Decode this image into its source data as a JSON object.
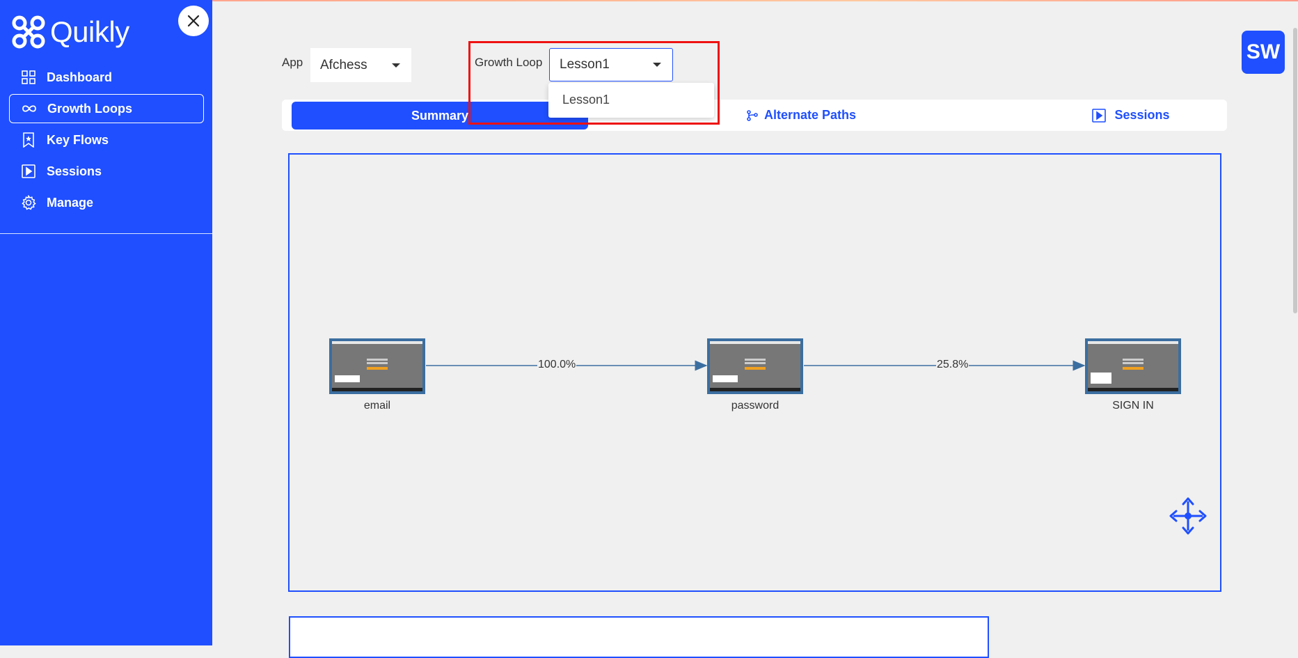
{
  "app_brand": "Quikly",
  "sidebar": {
    "items": [
      {
        "label": "Dashboard",
        "icon": "grid-icon",
        "active": false
      },
      {
        "label": "Growth Loops",
        "icon": "infinity-icon",
        "active": true
      },
      {
        "label": "Key Flows",
        "icon": "bookmark-icon",
        "active": false
      },
      {
        "label": "Sessions",
        "icon": "play-icon",
        "active": false
      },
      {
        "label": "Manage",
        "icon": "gear-icon",
        "active": false
      }
    ]
  },
  "filters": {
    "app_label": "App",
    "app_value": "Afchess",
    "growth_loop_label": "Growth Loop",
    "growth_loop_value": "Lesson1",
    "growth_loop_options": [
      "Lesson1"
    ]
  },
  "tabs": {
    "summary": "Summary",
    "alternate_paths": "Alternate Paths",
    "sessions": "Sessions"
  },
  "user": {
    "initials": "SW"
  },
  "flow": {
    "nodes": [
      {
        "label": "email"
      },
      {
        "label": "password"
      },
      {
        "label": "SIGN IN"
      }
    ],
    "edges": [
      {
        "from": "email",
        "to": "password",
        "label": "100.0%"
      },
      {
        "from": "password",
        "to": "SIGN IN",
        "label": "25.8%"
      }
    ]
  },
  "colors": {
    "brand": "#1f4ffe",
    "background": "#f0f0f0",
    "highlight": "#ee1111",
    "edge": "#3b6ea0"
  }
}
